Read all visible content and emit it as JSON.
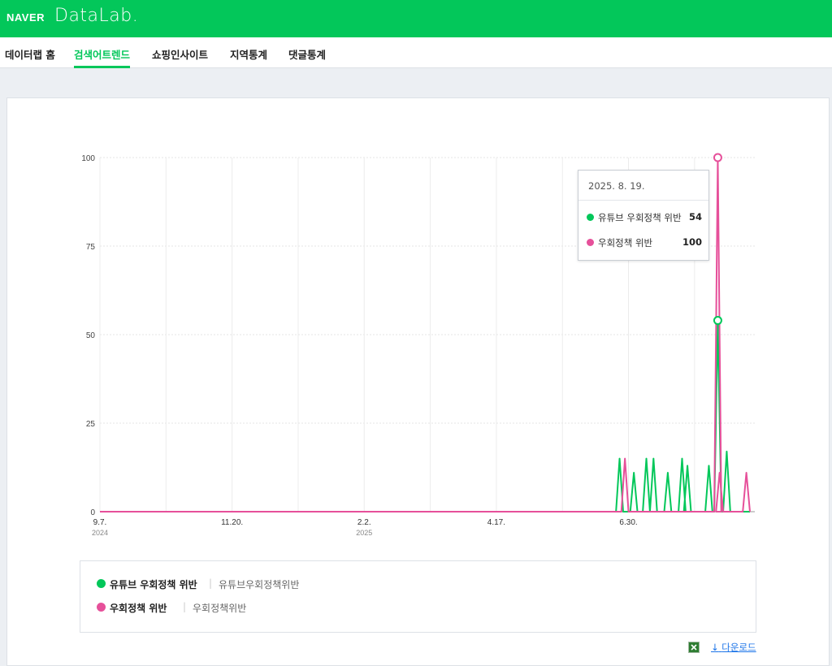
{
  "header": {
    "brand_naver": "NAVER",
    "brand_datalab": "DataLab.",
    "bg_color": "#03c75a"
  },
  "nav": {
    "items": [
      {
        "label": "데이터랩 홈",
        "active": false
      },
      {
        "label": "검색어트렌드",
        "active": true
      },
      {
        "label": "쇼핑인사이트",
        "active": false
      },
      {
        "label": "지역통계",
        "active": false
      },
      {
        "label": "댓글통계",
        "active": false
      }
    ]
  },
  "tooltip": {
    "date": "2025. 8. 19.",
    "rows": [
      {
        "name": "유튜브 우회정책 위반",
        "value": "54",
        "color": "#03c75a"
      },
      {
        "name": "우회정책 위반",
        "value": "100",
        "color": "#e6509a"
      }
    ]
  },
  "legend": {
    "items": [
      {
        "name": "유튜브 우회정책 위반",
        "keywords": "유튜브우회정책위반",
        "color": "#03c75a"
      },
      {
        "name": "우회정책 위반",
        "keywords": "우회정책위반",
        "color": "#e6509a"
      }
    ]
  },
  "download": {
    "label": "다운로드",
    "icon": "excel-icon"
  },
  "chart_data": {
    "type": "line",
    "ylim": [
      0,
      100
    ],
    "yticks": [
      "0",
      "25",
      "50",
      "75",
      "100"
    ],
    "x_start_label": "2024-09-07",
    "xticks": [
      {
        "label": "9.7.",
        "year": "2024",
        "date": "2024-09-07"
      },
      {
        "label": "11.20.",
        "year": "",
        "date": "2024-11-20"
      },
      {
        "label": "2.2.",
        "year": "2025",
        "date": "2025-02-02"
      },
      {
        "label": "4.17.",
        "year": "",
        "date": "2025-04-17"
      },
      {
        "label": "6.30.",
        "year": "",
        "date": "2025-06-30"
      }
    ],
    "x_end": "2025-09-06",
    "highlight_date": "2025-08-19",
    "series": [
      {
        "name": "유튜브 우회정책 위반",
        "color": "#03c75a",
        "spikes": [
          {
            "date": "2025-06-25",
            "value": 15
          },
          {
            "date": "2025-07-03",
            "value": 11
          },
          {
            "date": "2025-07-10",
            "value": 15
          },
          {
            "date": "2025-07-14",
            "value": 15
          },
          {
            "date": "2025-07-22",
            "value": 11
          },
          {
            "date": "2025-07-30",
            "value": 15
          },
          {
            "date": "2025-08-02",
            "value": 13
          },
          {
            "date": "2025-08-14",
            "value": 13
          },
          {
            "date": "2025-08-19",
            "value": 54
          },
          {
            "date": "2025-08-24",
            "value": 17
          }
        ]
      },
      {
        "name": "우회정책 위반",
        "color": "#e6509a",
        "spikes": [
          {
            "date": "2025-06-28",
            "value": 15
          },
          {
            "date": "2025-08-19",
            "value": 100
          },
          {
            "date": "2025-08-20",
            "value": 11
          },
          {
            "date": "2025-09-04",
            "value": 11
          }
        ]
      }
    ]
  }
}
